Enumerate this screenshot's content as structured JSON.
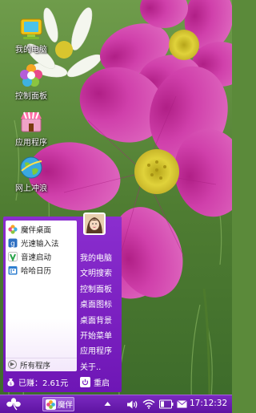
{
  "desktop": {
    "icons": [
      {
        "label": "我的电脑",
        "icon": "my-computer-icon"
      },
      {
        "label": "控制面板",
        "icon": "control-panel-icon"
      },
      {
        "label": "应用程序",
        "icon": "applications-icon"
      },
      {
        "label": "网上冲浪",
        "icon": "web-browser-icon"
      }
    ]
  },
  "start_menu": {
    "apps": [
      {
        "label": "魔伴桌面",
        "icon": "pinwheel-icon"
      },
      {
        "label": "光速输入法",
        "icon": "input-method-icon"
      },
      {
        "label": "音速启动",
        "icon": "quick-launch-icon"
      },
      {
        "label": "哈哈日历",
        "icon": "calendar-icon"
      }
    ],
    "all_programs": "所有程序",
    "right_links": [
      "我的电脑",
      "文明搜索",
      "控制面板",
      "桌面图标",
      "桌面背景",
      "开始菜单",
      "应用程序",
      "关于.."
    ],
    "earned": "已赚：2.61元",
    "restart": "重启"
  },
  "taskbar": {
    "task_label": "魔伴",
    "clock": "17:12:32",
    "tray_icons": [
      "up-arrow-icon",
      "speaker-icon",
      "wifi-icon",
      "battery-icon",
      "mail-icon"
    ]
  },
  "colors": {
    "menu_purple": "#7a1fc2",
    "taskbar_purple": "#6a1bb0",
    "flower_pink": "#d43fae"
  }
}
